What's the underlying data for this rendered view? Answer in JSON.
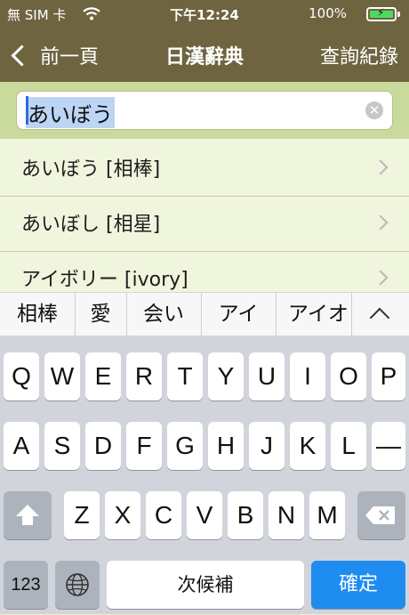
{
  "status": {
    "carrier": "無 SIM 卡",
    "wifi_icon": "wifi-icon",
    "time": "下午12:24",
    "battery_text": "100%",
    "battery_color": "#4cd964"
  },
  "nav": {
    "back_label": "前一頁",
    "title": "日漢辭典",
    "history_label": "查詢紀錄",
    "bar_color": "#6e6440"
  },
  "search": {
    "query": "あいぼう",
    "clear_icon": "clear-circle-icon"
  },
  "results": [
    {
      "text": "あいぼう [相棒]"
    },
    {
      "text": "あいぼし [相星]"
    },
    {
      "text": "アイボリー [ivory]"
    }
  ],
  "candidates": [
    "相棒",
    "愛",
    "会い",
    "アイ",
    "アイオ"
  ],
  "keyboard": {
    "row1": [
      "Q",
      "W",
      "E",
      "R",
      "T",
      "Y",
      "U",
      "I",
      "O",
      "P"
    ],
    "row2": [
      "A",
      "S",
      "D",
      "F",
      "G",
      "H",
      "J",
      "K",
      "L",
      "—"
    ],
    "row3": [
      "Z",
      "X",
      "C",
      "V",
      "B",
      "N",
      "M"
    ],
    "num_label": "123",
    "next_candidate_label": "次候補",
    "confirm_label": "確定",
    "accent_color": "#1f8cf0"
  }
}
